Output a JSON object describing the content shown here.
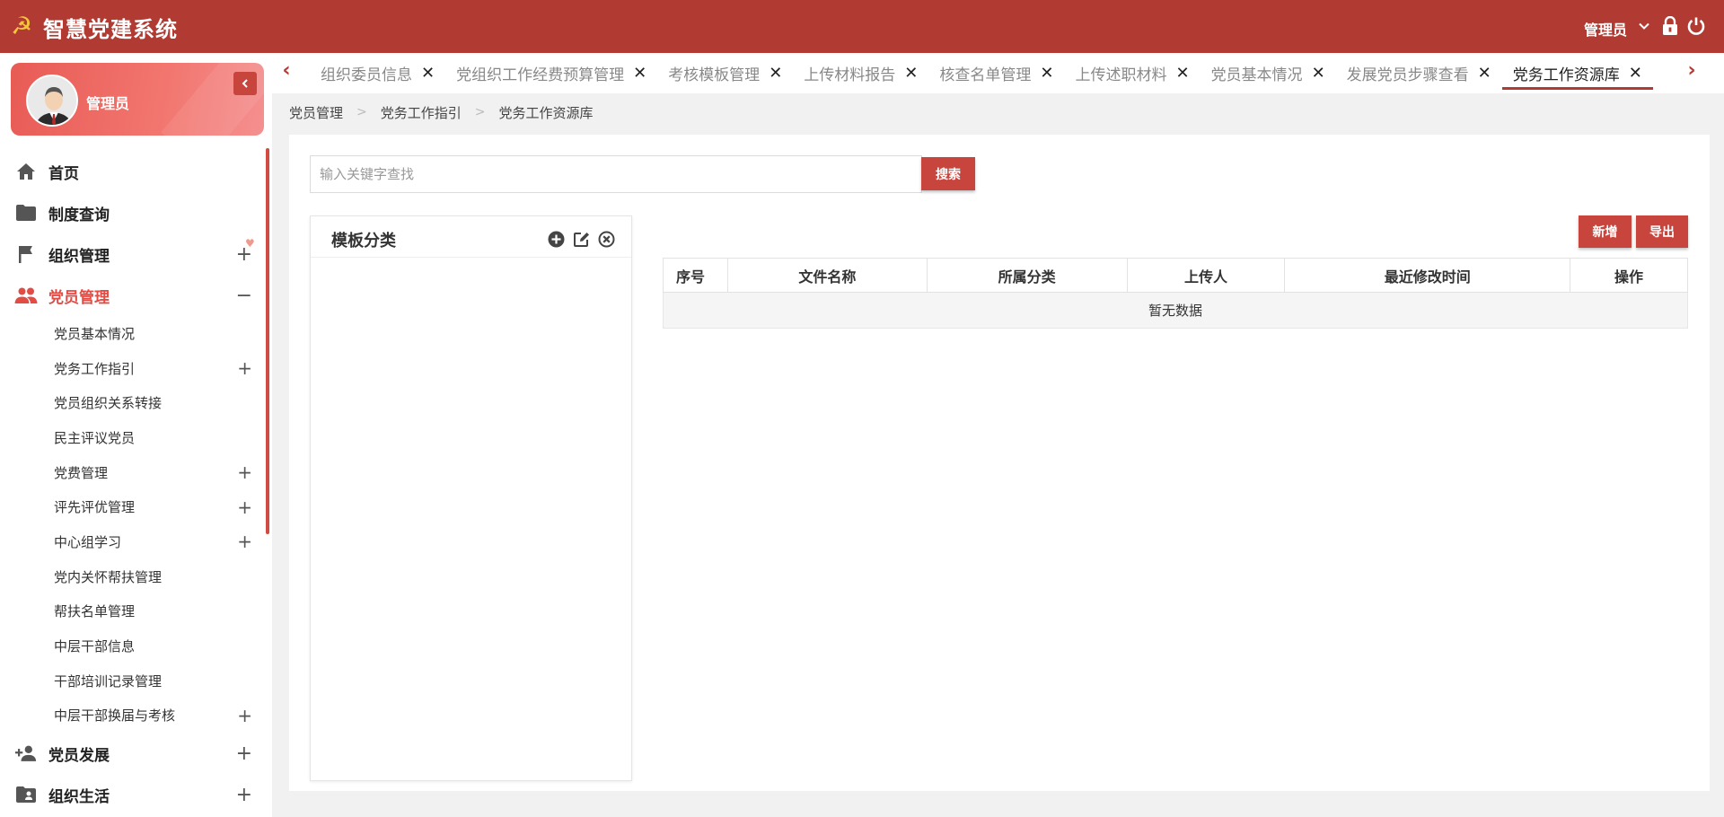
{
  "header": {
    "title": "智慧党建系统",
    "logo_icon": "hammer-sickle-icon",
    "user_label": "管理员",
    "icons": [
      "chevron-down-icon",
      "lock-icon",
      "power-icon"
    ],
    "color": "#b13a33"
  },
  "sidebar": {
    "profile_name": "管理员",
    "items": [
      {
        "label": "首页",
        "icon": "home-icon",
        "toggle": ""
      },
      {
        "label": "制度查询",
        "icon": "folder-icon",
        "toggle": ""
      },
      {
        "label": "组织管理",
        "icon": "flag-icon",
        "toggle": "+"
      },
      {
        "label": "党员管理",
        "icon": "people-icon",
        "toggle": "−"
      }
    ],
    "sub_items": [
      {
        "label": "党员基本情况",
        "toggle": ""
      },
      {
        "label": "党务工作指引",
        "toggle": "+"
      },
      {
        "label": "党员组织关系转接",
        "toggle": ""
      },
      {
        "label": "民主评议党员",
        "toggle": ""
      },
      {
        "label": "党费管理",
        "toggle": "+"
      },
      {
        "label": "评先评优管理",
        "toggle": "+"
      },
      {
        "label": "中心组学习",
        "toggle": "+"
      },
      {
        "label": "党内关怀帮扶管理",
        "toggle": ""
      },
      {
        "label": "帮扶名单管理",
        "toggle": ""
      },
      {
        "label": "中层干部信息",
        "toggle": ""
      },
      {
        "label": "干部培训记录管理",
        "toggle": ""
      },
      {
        "label": "中层干部换届与考核",
        "toggle": "+"
      }
    ],
    "bottom_items": [
      {
        "label": "党员发展",
        "icon": "add-person-icon",
        "toggle": "+"
      },
      {
        "label": "组织生活",
        "icon": "folder-person-icon",
        "toggle": "+"
      }
    ]
  },
  "tabs": [
    {
      "label": "组织委员信息"
    },
    {
      "label": "党组织工作经费预算管理"
    },
    {
      "label": "考核模板管理"
    },
    {
      "label": "上传材料报告"
    },
    {
      "label": "核查名单管理"
    },
    {
      "label": "上传述职材料"
    },
    {
      "label": "党员基本情况"
    },
    {
      "label": "发展党员步骤查看"
    },
    {
      "label": "党务工作资源库"
    }
  ],
  "breadcrumb": [
    "党员管理",
    "党务工作指引",
    "党务工作资源库"
  ],
  "search": {
    "placeholder": "输入关键字查找",
    "value": "",
    "button": "搜索"
  },
  "panel": {
    "title": "模板分类",
    "icons": [
      "add-circle-icon",
      "edit-icon",
      "delete-circle-icon"
    ]
  },
  "actions": {
    "add": "新增",
    "export": "导出"
  },
  "table": {
    "columns": [
      "序号",
      "文件名称",
      "所属分类",
      "上传人",
      "最近修改时间",
      "操作"
    ],
    "empty_text": "暂无数据"
  }
}
